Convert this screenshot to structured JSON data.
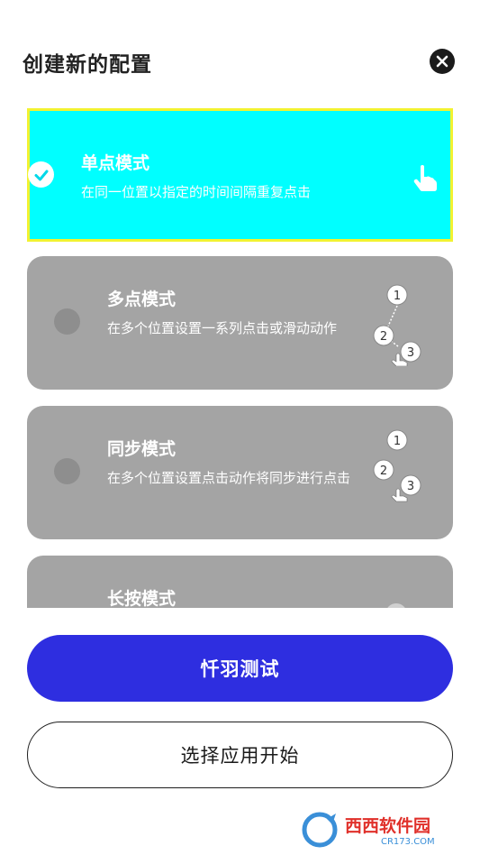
{
  "dialog": {
    "title": "创建新的配置"
  },
  "modes": [
    {
      "title": "单点模式",
      "description": "在同一位置以指定的时间间隔重复点击",
      "selected": true,
      "icon": "single-tap-hand-icon"
    },
    {
      "title": "多点模式",
      "description": "在多个位置设置一系列点击或滑动动作",
      "selected": false,
      "icon": "multi-tap-sequence-icon",
      "markers": [
        "1",
        "2",
        "3"
      ]
    },
    {
      "title": "同步模式",
      "description": "在多个位置设置点击动作将同步进行点击",
      "selected": false,
      "icon": "sync-tap-icon",
      "markers": [
        "1",
        "2",
        "3"
      ]
    },
    {
      "title": "长按模式",
      "selected": false,
      "icon": "long-press-icon"
    }
  ],
  "buttons": {
    "primary_label": "忏羽测试",
    "secondary_label": "选择应用开始"
  },
  "watermark": {
    "brand": "西西软件园",
    "domain": "CR173.COM"
  },
  "colors": {
    "selected_card": "#00ffff",
    "selected_border": "#f2f230",
    "unselected_card": "#a4a4a4",
    "primary_button": "#2e2ee0"
  }
}
